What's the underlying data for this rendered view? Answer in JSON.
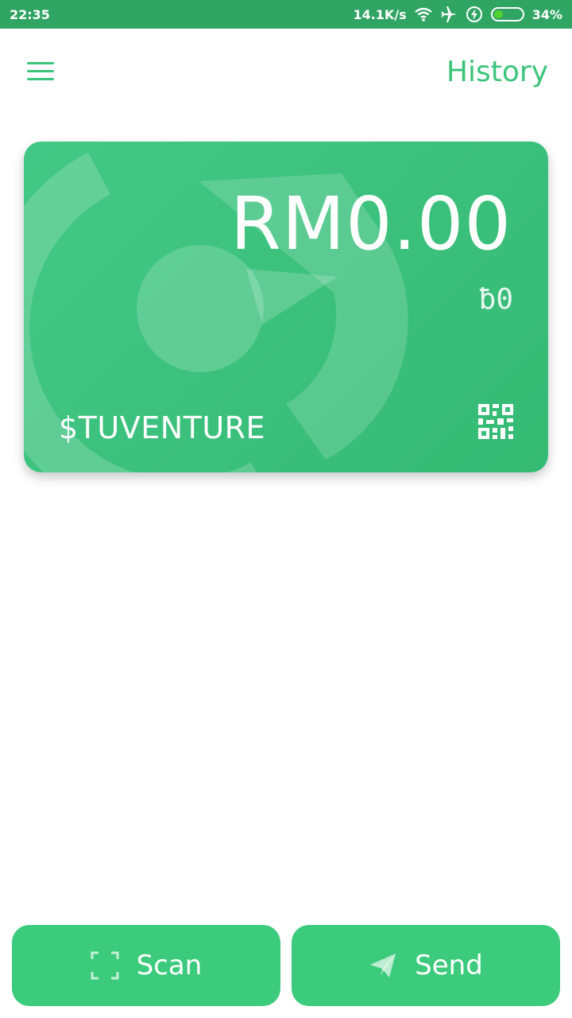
{
  "status_bar": {
    "time": "22:35",
    "net_speed": "14.1K/s",
    "battery_percent": "34%",
    "battery_level": 0.34,
    "icons": [
      "wifi-icon",
      "airplane-icon",
      "charging-icon",
      "battery-icon"
    ]
  },
  "app_bar": {
    "menu_icon": "hamburger-menu-icon",
    "history_label": "History"
  },
  "card": {
    "amount": "RM0.00",
    "points": "ƀ0",
    "brand": "$TUVENTURE",
    "qr_icon": "qr-code-icon"
  },
  "actions": {
    "scan_label": "Scan",
    "scan_icon": "scan-frame-icon",
    "send_label": "Send",
    "send_icon": "paper-plane-icon"
  },
  "colors": {
    "status_bar": "#2fa463",
    "accent": "#3cc47a",
    "card": "#3cc27f",
    "button": "#3ccb7c"
  }
}
